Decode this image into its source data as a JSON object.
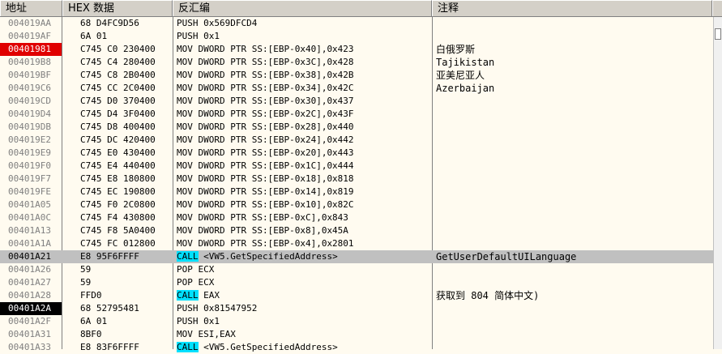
{
  "headers": {
    "address": "地址",
    "hex": "HEX 数据",
    "disasm": "反汇编",
    "comment": "注释"
  },
  "rows": [
    {
      "addr": "004019AA",
      "hex": "68 D4FC9D56",
      "mn": "PUSH",
      "ops": " 0x569DFCD4",
      "cmt": ""
    },
    {
      "addr": "004019AF",
      "hex": "6A 01",
      "mn": "PUSH",
      "ops": " 0x1",
      "cmt": ""
    },
    {
      "addr": "00401981",
      "hex": "C745 C0 230400",
      "mn": "MOV",
      "ops": " DWORD PTR SS:[EBP-0x40],0x423",
      "cmt": "白俄罗斯"
    },
    {
      "addr": "004019B8",
      "hex": "C745 C4 280400",
      "mn": "MOV",
      "ops": " DWORD PTR SS:[EBP-0x3C],0x428",
      "cmt": "Tajikistan"
    },
    {
      "addr": "004019BF",
      "hex": "C745 C8 2B0400",
      "mn": "MOV",
      "ops": " DWORD PTR SS:[EBP-0x38],0x42B",
      "cmt": "亚美尼亚人"
    },
    {
      "addr": "004019C6",
      "hex": "C745 CC 2C0400",
      "mn": "MOV",
      "ops": " DWORD PTR SS:[EBP-0x34],0x42C",
      "cmt": "Azerbaijan"
    },
    {
      "addr": "004019CD",
      "hex": "C745 D0 370400",
      "mn": "MOV",
      "ops": " DWORD PTR SS:[EBP-0x30],0x437",
      "cmt": ""
    },
    {
      "addr": "004019D4",
      "hex": "C745 D4 3F0400",
      "mn": "MOV",
      "ops": " DWORD PTR SS:[EBP-0x2C],0x43F",
      "cmt": ""
    },
    {
      "addr": "004019DB",
      "hex": "C745 D8 400400",
      "mn": "MOV",
      "ops": " DWORD PTR SS:[EBP-0x28],0x440",
      "cmt": ""
    },
    {
      "addr": "004019E2",
      "hex": "C745 DC 420400",
      "mn": "MOV",
      "ops": " DWORD PTR SS:[EBP-0x24],0x442",
      "cmt": ""
    },
    {
      "addr": "004019E9",
      "hex": "C745 E0 430400",
      "mn": "MOV",
      "ops": " DWORD PTR SS:[EBP-0x20],0x443",
      "cmt": ""
    },
    {
      "addr": "004019F0",
      "hex": "C745 E4 440400",
      "mn": "MOV",
      "ops": " DWORD PTR SS:[EBP-0x1C],0x444",
      "cmt": ""
    },
    {
      "addr": "004019F7",
      "hex": "C745 E8 180800",
      "mn": "MOV",
      "ops": " DWORD PTR SS:[EBP-0x18],0x818",
      "cmt": ""
    },
    {
      "addr": "004019FE",
      "hex": "C745 EC 190800",
      "mn": "MOV",
      "ops": " DWORD PTR SS:[EBP-0x14],0x819",
      "cmt": ""
    },
    {
      "addr": "00401A05",
      "hex": "C745 F0 2C0800",
      "mn": "MOV",
      "ops": " DWORD PTR SS:[EBP-0x10],0x82C",
      "cmt": ""
    },
    {
      "addr": "00401A0C",
      "hex": "C745 F4 430800",
      "mn": "MOV",
      "ops": " DWORD PTR SS:[EBP-0xC],0x843",
      "cmt": ""
    },
    {
      "addr": "00401A13",
      "hex": "C745 F8 5A0400",
      "mn": "MOV",
      "ops": " DWORD PTR SS:[EBP-0x8],0x45A",
      "cmt": ""
    },
    {
      "addr": "00401A1A",
      "hex": "C745 FC 012800",
      "mn": "MOV",
      "ops": " DWORD PTR SS:[EBP-0x4],0x2801",
      "cmt": ""
    },
    {
      "addr": "00401A21",
      "hex": "E8 95F6FFFF",
      "mn": "CALL",
      "ops": " <VW5.GetSpecifiedAddress>",
      "cmt": "GetUserDefaultUILanguage"
    },
    {
      "addr": "00401A26",
      "hex": "59",
      "mn": "POP",
      "ops": " ECX",
      "cmt": ""
    },
    {
      "addr": "00401A27",
      "hex": "59",
      "mn": "POP",
      "ops": " ECX",
      "cmt": ""
    },
    {
      "addr": "00401A28",
      "hex": "FFD0",
      "mn": "CALL",
      "ops": " EAX",
      "cmt": "获取到 804 简体中文)"
    },
    {
      "addr": "00401A2A",
      "hex": "68 52795481",
      "mn": "PUSH",
      "ops": " 0x81547952",
      "cmt": ""
    },
    {
      "addr": "00401A2F",
      "hex": "6A 01",
      "mn": "PUSH",
      "ops": " 0x1",
      "cmt": ""
    },
    {
      "addr": "00401A31",
      "hex": "8BF0",
      "mn": "MOV",
      "ops": " ESI,EAX",
      "cmt": ""
    },
    {
      "addr": "00401A33",
      "hex": "E8 83F6FFFF",
      "mn": "CALL",
      "ops": " <VW5.GetSpecifiedAddress>",
      "cmt": ""
    }
  ]
}
